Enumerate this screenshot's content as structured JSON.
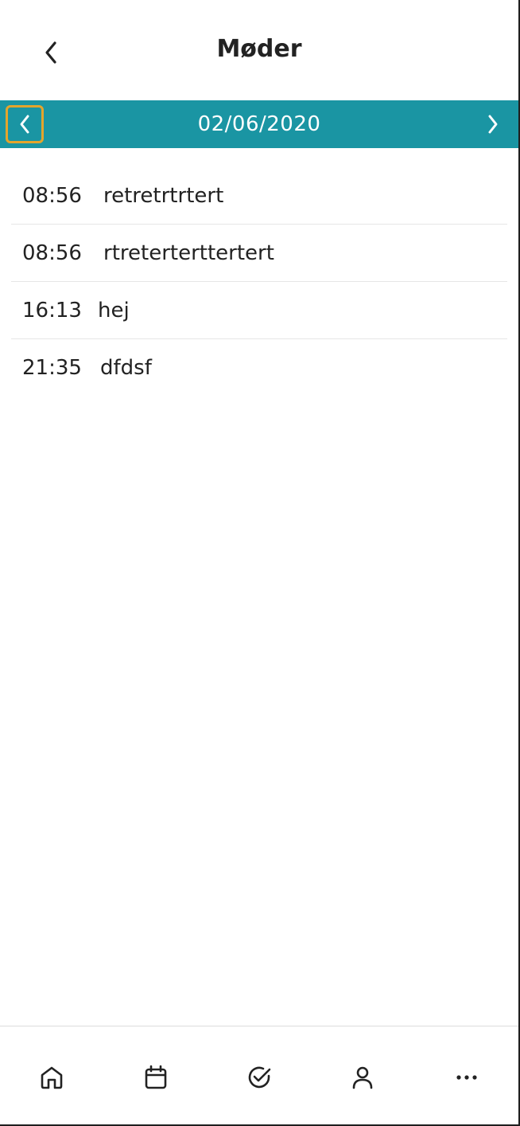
{
  "header": {
    "title": "Møder",
    "back_icon": "chevron-left-icon"
  },
  "date_bar": {
    "date": "02/06/2020",
    "prev_icon": "chevron-left-icon",
    "next_icon": "chevron-right-icon",
    "color": "#1a95a3",
    "focus_color": "#e3a52c"
  },
  "meetings": [
    {
      "time": "08:56",
      "subject": "retretrtrtert"
    },
    {
      "time": "08:56",
      "subject": "rtreterterttertert"
    },
    {
      "time": "16:13",
      "subject": "hej"
    },
    {
      "time": "21:35",
      "subject": "dfdsf"
    }
  ],
  "tabs": [
    {
      "id": "home",
      "icon": "home-icon"
    },
    {
      "id": "calendar",
      "icon": "calendar-icon"
    },
    {
      "id": "tasks",
      "icon": "check-circle-icon"
    },
    {
      "id": "profile",
      "icon": "user-icon"
    },
    {
      "id": "more",
      "icon": "more-icon"
    }
  ]
}
